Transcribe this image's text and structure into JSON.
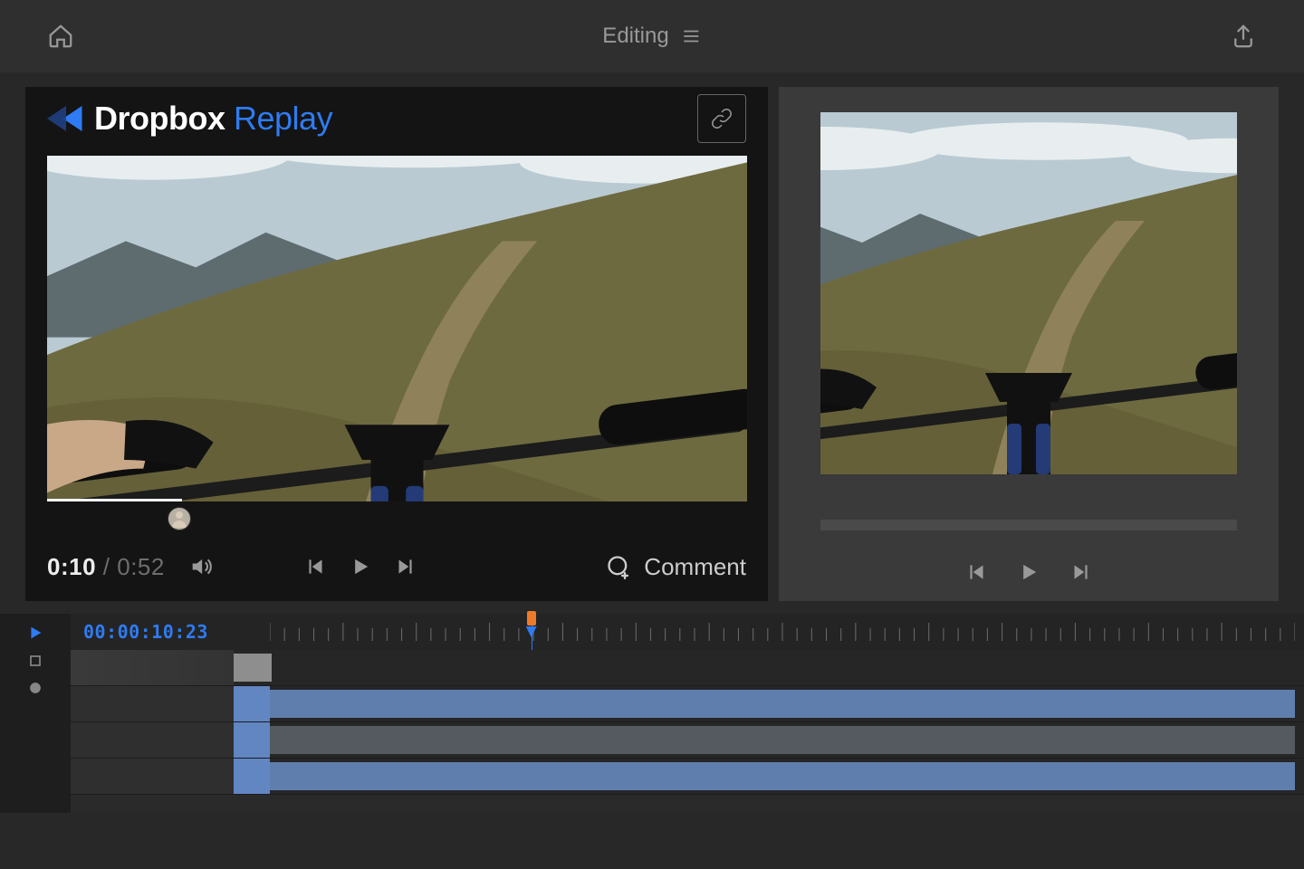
{
  "topbar": {
    "center_label": "Editing"
  },
  "replay": {
    "brand": "Dropbox",
    "product": "Replay",
    "current_time": "0:10",
    "duration": "0:52",
    "comment_label": "Comment"
  },
  "timeline": {
    "timecode": "00:00:10:23",
    "playhead_fraction": 0.255,
    "tracks": [
      {
        "type": "video-head",
        "thumb": true
      },
      {
        "type": "clip",
        "color": "blue",
        "head_color": "#6186c2",
        "start": 0.0,
        "end": 1.0
      },
      {
        "type": "clip",
        "color": "grey",
        "head_color": "#6186c2",
        "start": 0.0,
        "end": 1.0
      },
      {
        "type": "clip",
        "color": "blue",
        "head_color": "#6186c2",
        "start": 0.0,
        "end": 1.0
      }
    ]
  },
  "icons": {
    "home": "home-icon",
    "menu": "menu-icon",
    "share": "share-icon",
    "link": "link-icon",
    "volume": "volume-icon",
    "step_back": "step-back-icon",
    "play": "play-icon",
    "step_fwd": "step-forward-icon",
    "add_comment": "add-comment-icon",
    "tl_play": "timeline-play-icon",
    "tl_stop": "timeline-stop-icon",
    "tl_record": "timeline-record-icon"
  },
  "colors": {
    "accent": "#2f7bf2",
    "orange": "#ee7a2b",
    "clip_blue": "#5f7eae",
    "clip_grey": "#555a60",
    "panel_dark": "#141414",
    "panel_mid": "#3a3a3a"
  }
}
